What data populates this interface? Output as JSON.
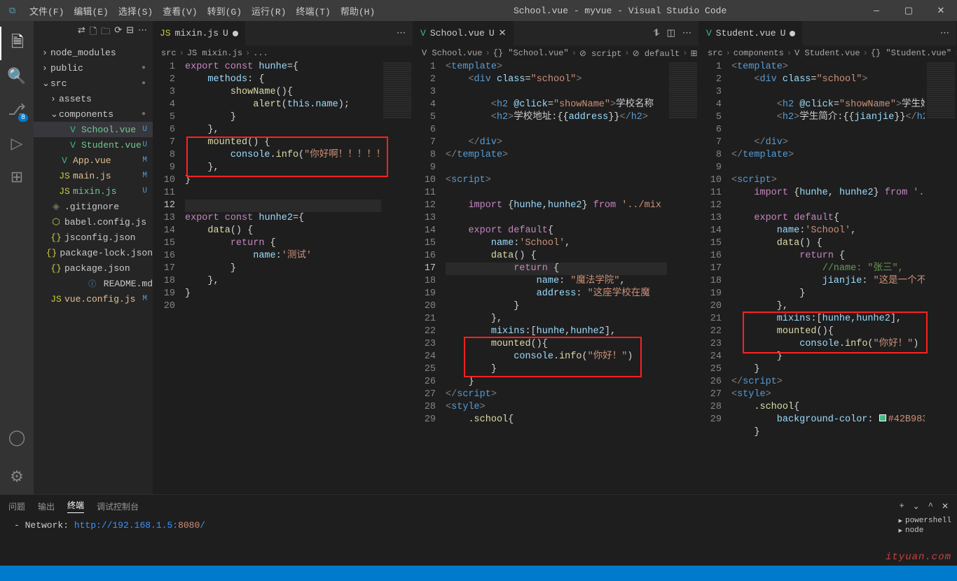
{
  "title": "School.vue - myvue - Visual Studio Code",
  "menu": [
    "文件(F)",
    "编辑(E)",
    "选择(S)",
    "查看(V)",
    "转到(G)",
    "运行(R)",
    "终端(T)",
    "帮助(H)"
  ],
  "activity": {
    "badge": "8"
  },
  "explorer": {
    "items": [
      {
        "type": "folder",
        "chev": "›",
        "label": "node_modules",
        "indent": 0,
        "cls": ""
      },
      {
        "type": "folder",
        "chev": "›",
        "label": "public",
        "indent": 0,
        "cls": "",
        "dot": "●"
      },
      {
        "type": "folder",
        "chev": "⌄",
        "label": "src",
        "indent": 0,
        "cls": "",
        "dot": "●"
      },
      {
        "type": "folder",
        "chev": "›",
        "label": "assets",
        "indent": 1,
        "cls": ""
      },
      {
        "type": "folder",
        "chev": "⌄",
        "label": "components",
        "indent": 1,
        "cls": "",
        "dot": "●"
      },
      {
        "type": "file",
        "ico": "V",
        "label": "School.vue",
        "indent": 2,
        "cls": "unt sel",
        "tag": "U",
        "icoCls": "vue-ico"
      },
      {
        "type": "file",
        "ico": "V",
        "label": "Student.vue",
        "indent": 2,
        "cls": "unt",
        "tag": "U",
        "icoCls": "vue-ico"
      },
      {
        "type": "file",
        "ico": "V",
        "label": "App.vue",
        "indent": 1,
        "cls": "mod",
        "tag": "M",
        "icoCls": "vue-ico"
      },
      {
        "type": "file",
        "ico": "JS",
        "label": "main.js",
        "indent": 1,
        "cls": "mod",
        "tag": "M",
        "icoCls": "js-ico"
      },
      {
        "type": "file",
        "ico": "JS",
        "label": "mixin.js",
        "indent": 1,
        "cls": "unt",
        "tag": "U",
        "icoCls": "js-ico"
      },
      {
        "type": "file",
        "ico": "◈",
        "label": ".gitignore",
        "indent": 0,
        "cls": "",
        "icoCls": "dim"
      },
      {
        "type": "file",
        "ico": "⬡",
        "label": "babel.config.js",
        "indent": 0,
        "cls": "",
        "icoCls": "js-ico"
      },
      {
        "type": "file",
        "ico": "{}",
        "label": "jsconfig.json",
        "indent": 0,
        "cls": "",
        "icoCls": "js-ico"
      },
      {
        "type": "file",
        "ico": "{}",
        "label": "package-lock.json",
        "indent": 0,
        "cls": "",
        "icoCls": "js-ico"
      },
      {
        "type": "file",
        "ico": "{}",
        "label": "package.json",
        "indent": 0,
        "cls": "",
        "icoCls": "js-ico"
      },
      {
        "type": "file",
        "ico": "ⓘ",
        "label": "README.md",
        "indent": 0,
        "cls": "",
        "icoCls": "tag"
      },
      {
        "type": "file",
        "ico": "JS",
        "label": "vue.config.js",
        "indent": 0,
        "cls": "mod",
        "tag": "M",
        "icoCls": "js-ico"
      }
    ]
  },
  "pane1": {
    "tab": {
      "ico": "JS",
      "icoCls": "js-ico",
      "name": "mixin.js",
      "status": "U",
      "statusCls": "unt",
      "mod": true
    },
    "crumbs": [
      "src",
      "›",
      "JS mixin.js",
      "›",
      "..."
    ],
    "lines": [
      1,
      2,
      3,
      4,
      5,
      6,
      7,
      8,
      9,
      10,
      11,
      12,
      13,
      14,
      15,
      16,
      17,
      18,
      19,
      20
    ],
    "curLine": 12
  },
  "pane2": {
    "tab": {
      "ico": "V",
      "icoCls": "vue-ico",
      "name": "School.vue",
      "status": "U",
      "statusCls": "unt",
      "close": true
    },
    "crumbs": [
      "V School.vue",
      "›",
      "{} \"School.vue\"",
      "›",
      "⊘ script",
      "›",
      "⊘ default",
      "›",
      "⊞ data"
    ],
    "lines": [
      1,
      2,
      3,
      4,
      5,
      6,
      7,
      8,
      9,
      10,
      11,
      12,
      13,
      14,
      15,
      16,
      17,
      18,
      19,
      20,
      21,
      22,
      23,
      24,
      25,
      26,
      27,
      28,
      29
    ],
    "curLine": 17
  },
  "pane3": {
    "tab": {
      "ico": "V",
      "icoCls": "vue-ico",
      "name": "Student.vue",
      "status": "U",
      "statusCls": "unt",
      "mod": true
    },
    "crumbs": [
      "src",
      "›",
      "components",
      "›",
      "V Student.vue",
      "›",
      "{} \"Student.vue\"",
      "›",
      "⊘ sc"
    ],
    "lines": [
      1,
      2,
      3,
      4,
      5,
      6,
      7,
      8,
      9,
      10,
      11,
      12,
      13,
      14,
      15,
      16,
      17,
      18,
      19,
      20,
      21,
      22,
      23,
      24,
      25,
      26,
      27,
      28,
      29
    ]
  },
  "panel": {
    "tabs": [
      "问题",
      "输出",
      "终端",
      "调试控制台"
    ],
    "active": 2,
    "network_label": "- Network: ",
    "network_url": "http://192.168.1.5:",
    "network_port": "8080",
    "network_slash": "/",
    "terms": [
      "powershell",
      "node"
    ]
  },
  "watermark": "ityuan.com"
}
